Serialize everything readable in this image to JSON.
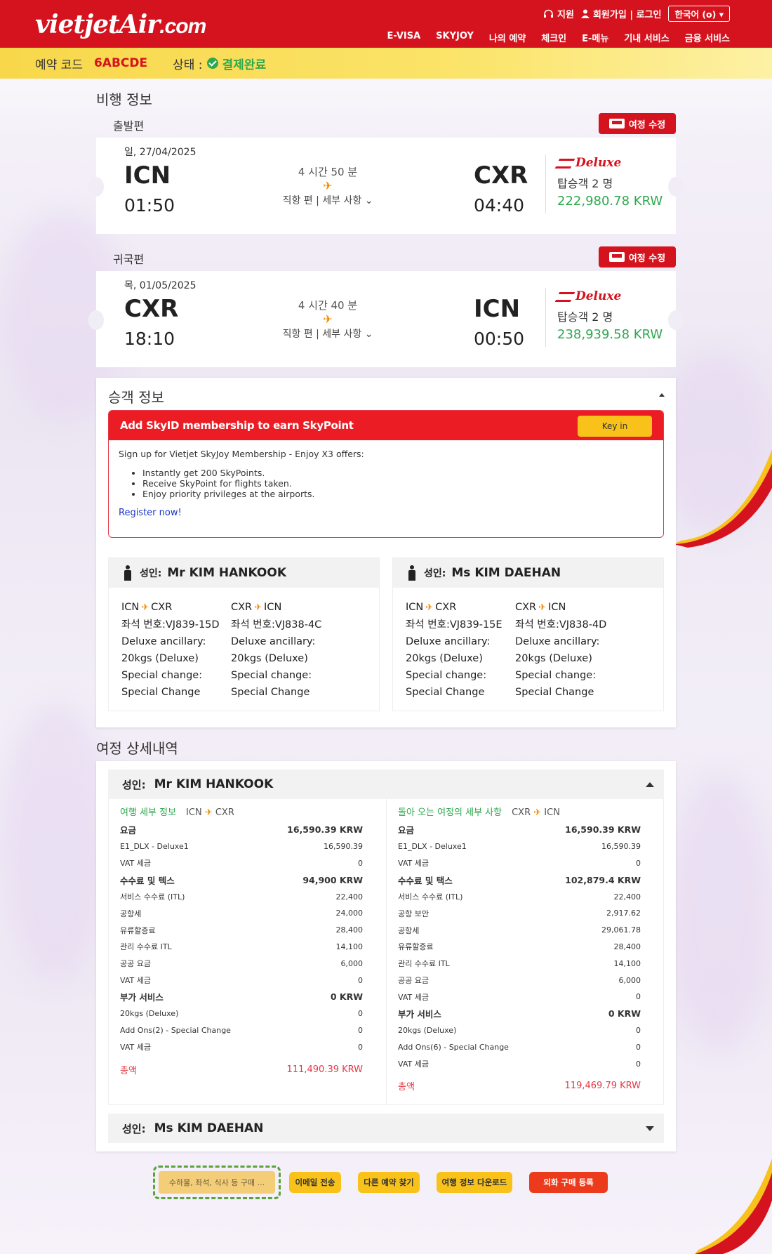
{
  "header": {
    "logo_main": "vietjetAir",
    "logo_suffix": ".com",
    "util": {
      "support": "지원",
      "signup_login": "회원가입 | 로그인",
      "language": "한국어 (o)"
    },
    "nav": [
      "E-VISA",
      "SKYJOY",
      "나의 예약",
      "체크인",
      "E-메뉴",
      "기내 서비스",
      "금융 서비스"
    ]
  },
  "booking": {
    "code_label": "예약 코드",
    "code": "6ABCDE",
    "status_label": "상태 :",
    "status": "결제완료"
  },
  "flight_info": {
    "title": "비행 정보",
    "modify_label": "여정 수정",
    "outbound": {
      "label": "출발편",
      "date": "일, 27/04/2025",
      "from_code": "ICN",
      "from_time": "01:50",
      "to_code": "CXR",
      "to_time": "04:40",
      "duration": "4 시간 50 분",
      "detail": "직항 편 | 세부 사항",
      "fare_brand": "Deluxe",
      "passengers": "탑승객 2 명",
      "price": "222,980.78 KRW"
    },
    "inbound": {
      "label": "귀국편",
      "date": "목, 01/05/2025",
      "from_code": "CXR",
      "from_time": "18:10",
      "to_code": "ICN",
      "to_time": "00:50",
      "duration": "4 시간 40 분",
      "detail": "직항 편 | 세부 사항",
      "fare_brand": "Deluxe",
      "passengers": "탑승객 2 명",
      "price": "238,939.58 KRW"
    }
  },
  "passenger_info": {
    "title": "승객 정보",
    "skyid": {
      "heading": "Add SkyID membership to earn SkyPoint",
      "keyin": "Key in",
      "intro": "Sign up for Vietjet SkyJoy Membership - Enjoy X3 offers:",
      "bullets": [
        "Instantly get 200 SkyPoints.",
        "Receive SkyPoint for flights taken.",
        "Enjoy priority privileges at the airports."
      ],
      "register": "Register now!"
    },
    "passengers": [
      {
        "type": "성인:",
        "name": "Mr KIM HANKOOK",
        "legs": [
          {
            "from": "ICN",
            "to": "CXR",
            "seat": "좌석 번호:VJ839-15D",
            "ancillary": "Deluxe ancillary: 20kgs (Deluxe)",
            "special": "Special change: Special Change"
          },
          {
            "from": "CXR",
            "to": "ICN",
            "seat": "좌석 번호:VJ838-4C",
            "ancillary": "Deluxe ancillary: 20kgs (Deluxe)",
            "special": "Special change: Special Change"
          }
        ]
      },
      {
        "type": "성인:",
        "name": "Ms KIM DAEHAN",
        "legs": [
          {
            "from": "ICN",
            "to": "CXR",
            "seat": "좌석 번호:VJ839-15E",
            "ancillary": "Deluxe ancillary: 20kgs (Deluxe)",
            "special": "Special change: Special Change"
          },
          {
            "from": "CXR",
            "to": "ICN",
            "seat": "좌석 번호:VJ838-4D",
            "ancillary": "Deluxe ancillary: 20kgs (Deluxe)",
            "special": "Special change: Special Change"
          }
        ]
      }
    ]
  },
  "itinerary_details": {
    "title": "여정 상세내역",
    "expanded": {
      "type": "성인:",
      "name": "Mr KIM HANKOOK",
      "outbound": {
        "title": "여행 세부 정보",
        "from": "ICN",
        "to": "CXR",
        "rows": [
          {
            "label": "요금",
            "value": "16,590.39 KRW",
            "bold": true
          },
          {
            "label": "E1_DLX - Deluxe1",
            "value": "16,590.39"
          },
          {
            "label": "VAT 세금",
            "value": "0"
          },
          {
            "label": "수수료 및 텍스",
            "value": "94,900 KRW",
            "bold": true
          },
          {
            "label": "서비스 수수료 (ITL)",
            "value": "22,400"
          },
          {
            "label": "공항세",
            "value": "24,000"
          },
          {
            "label": "유류할증료",
            "value": "28,400"
          },
          {
            "label": "관리 수수료 ITL",
            "value": "14,100"
          },
          {
            "label": "공공 요금",
            "value": "6,000"
          },
          {
            "label": "VAT 세금",
            "value": "0"
          },
          {
            "label": "부가 서비스",
            "value": "0 KRW",
            "bold": true
          },
          {
            "label": "20kgs (Deluxe)",
            "value": "0"
          },
          {
            "label": "Add Ons(2) - Special Change",
            "value": "0"
          },
          {
            "label": "VAT 세금",
            "value": "0"
          }
        ],
        "total_label": "총액",
        "total": "111,490.39 KRW"
      },
      "return": {
        "title": "돌아 오는 여정의 세부 사항",
        "from": "CXR",
        "to": "ICN",
        "rows": [
          {
            "label": "요금",
            "value": "16,590.39 KRW",
            "bold": true
          },
          {
            "label": "E1_DLX - Deluxe1",
            "value": "16,590.39"
          },
          {
            "label": "VAT 세금",
            "value": "0"
          },
          {
            "label": "수수료 및 택스",
            "value": "102,879.4 KRW",
            "bold": true
          },
          {
            "label": "서비스 수수료 (ITL)",
            "value": "22,400"
          },
          {
            "label": "공항 보안",
            "value": "2,917.62"
          },
          {
            "label": "공항세",
            "value": "29,061.78"
          },
          {
            "label": "유류할증료",
            "value": "28,400"
          },
          {
            "label": "관리 수수료 ITL",
            "value": "14,100"
          },
          {
            "label": "공공 요금",
            "value": "6,000"
          },
          {
            "label": "VAT 세금",
            "value": "0"
          },
          {
            "label": "부가 서비스",
            "value": "0 KRW",
            "bold": true
          },
          {
            "label": "20kgs (Deluxe)",
            "value": "0"
          },
          {
            "label": "Add Ons(6) - Special Change",
            "value": "0"
          },
          {
            "label": "VAT 세금",
            "value": "0"
          }
        ],
        "total_label": "총액",
        "total": "119,469.79 KRW"
      }
    },
    "collapsed": {
      "type": "성인:",
      "name": "Ms KIM DAEHAN"
    }
  },
  "actions": {
    "addons": "수하물, 좌석, 식사 등 구매 ...",
    "email": "이메일 전송",
    "find_other": "다른 예약 찾기",
    "download": "여행 정보 다운로드",
    "fx": "외화 구매 등록"
  },
  "colors": {
    "brand_red": "#d5131e",
    "accent_yellow": "#f8c21b",
    "success_green": "#2fa84f"
  }
}
